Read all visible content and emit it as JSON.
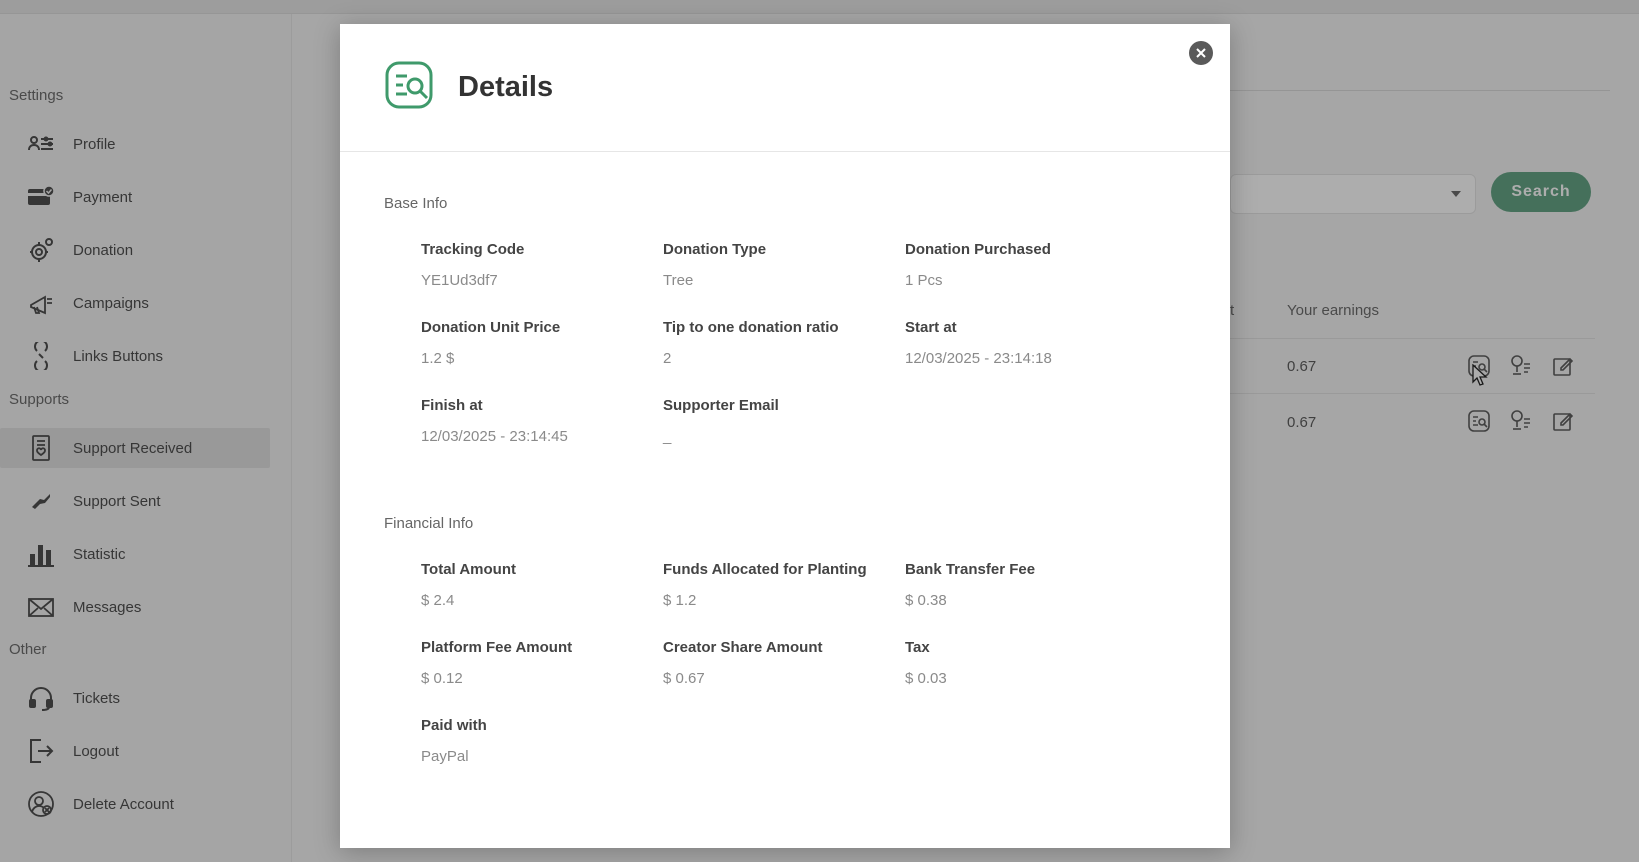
{
  "sidebar": {
    "sections": {
      "settings": "Settings",
      "supports": "Supports",
      "other": "Other"
    },
    "items": {
      "profile": "Profile",
      "payment": "Payment",
      "donation": "Donation",
      "campaigns": "Campaigns",
      "links_buttons": "Links Buttons",
      "support_received": "Support Received",
      "support_sent": "Support Sent",
      "statistic": "Statistic",
      "messages": "Messages",
      "tickets": "Tickets",
      "logout": "Logout",
      "delete_account": "Delete Account"
    },
    "active": "support_received"
  },
  "main": {
    "search_label": "Search",
    "columns": {
      "truncated": "t",
      "earnings": "Your earnings"
    },
    "rows": [
      {
        "earnings": "0.67"
      },
      {
        "earnings": "0.67"
      }
    ]
  },
  "modal": {
    "title": "Details",
    "base_info": {
      "heading": "Base Info",
      "tracking_code": {
        "label": "Tracking Code",
        "value": "YE1Ud3df7"
      },
      "donation_type": {
        "label": "Donation Type",
        "value": "Tree"
      },
      "donation_purchased": {
        "label": "Donation Purchased",
        "value": "1 Pcs"
      },
      "donation_unit_price": {
        "label": "Donation Unit Price",
        "value": "1.2 $"
      },
      "tip_ratio": {
        "label": "Tip to one donation ratio",
        "value": "2"
      },
      "start_at": {
        "label": "Start at",
        "value": "12/03/2025 - 23:14:18"
      },
      "finish_at": {
        "label": "Finish at",
        "value": "12/03/2025 - 23:14:45"
      },
      "supporter_email": {
        "label": "Supporter Email",
        "value": "_"
      }
    },
    "financial_info": {
      "heading": "Financial Info",
      "total_amount": {
        "label": "Total Amount",
        "value": "$ 2.4"
      },
      "funds_planting": {
        "label": "Funds Allocated for Planting",
        "value": "$ 1.2"
      },
      "bank_fee": {
        "label": "Bank Transfer Fee",
        "value": "$ 0.38"
      },
      "platform_fee": {
        "label": "Platform Fee Amount",
        "value": "$ 0.12"
      },
      "creator_share": {
        "label": "Creator Share Amount",
        "value": "$ 0.67"
      },
      "tax": {
        "label": "Tax",
        "value": "$ 0.03"
      },
      "paid_with": {
        "label": "Paid with",
        "value": "PayPal"
      }
    }
  },
  "colors": {
    "accent_green": "#4c9672",
    "icon_green": "#3f9a6b"
  },
  "icons": {
    "details": "details-search-icon",
    "close": "close-icon"
  }
}
